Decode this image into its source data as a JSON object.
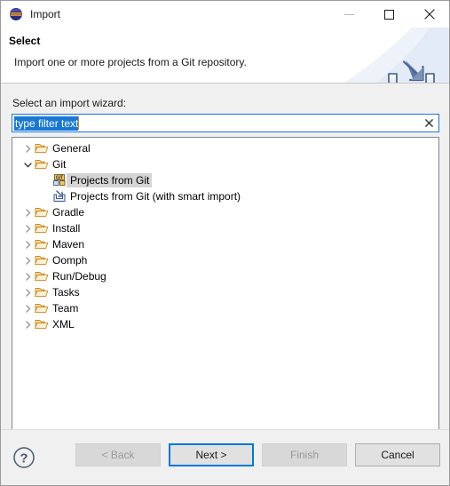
{
  "window": {
    "title": "Import",
    "app_icon": "eclipse-icon",
    "controls": [
      {
        "name": "minimize-button",
        "glyph": "minimize-icon",
        "enabled": false
      },
      {
        "name": "maximize-button",
        "glyph": "maximize-icon",
        "enabled": true
      },
      {
        "name": "close-button",
        "glyph": "close-icon",
        "enabled": true
      }
    ]
  },
  "header": {
    "title": "Select",
    "description": "Import one or more projects from a Git repository.",
    "icon": "import-wizard-icon"
  },
  "main": {
    "field_label": "Select an import wizard:",
    "filter": {
      "value": "type filter text",
      "placeholder": "type filter text",
      "selected": true,
      "clear_icon": "clear-x-icon"
    },
    "tree": [
      {
        "label": "General",
        "level": 1,
        "icon": "folder-icon",
        "expanded": false,
        "has_children": true,
        "selected": false
      },
      {
        "label": "Git",
        "level": 1,
        "icon": "folder-icon",
        "expanded": true,
        "has_children": true,
        "selected": false
      },
      {
        "label": "Projects from Git",
        "level": 2,
        "icon": "git-wizard-icon",
        "expanded": false,
        "has_children": false,
        "selected": true
      },
      {
        "label": "Projects from Git (with smart import)",
        "level": 2,
        "icon": "smart-import-icon",
        "expanded": false,
        "has_children": false,
        "selected": false
      },
      {
        "label": "Gradle",
        "level": 1,
        "icon": "folder-icon",
        "expanded": false,
        "has_children": true,
        "selected": false
      },
      {
        "label": "Install",
        "level": 1,
        "icon": "folder-icon",
        "expanded": false,
        "has_children": true,
        "selected": false
      },
      {
        "label": "Maven",
        "level": 1,
        "icon": "folder-icon",
        "expanded": false,
        "has_children": true,
        "selected": false
      },
      {
        "label": "Oomph",
        "level": 1,
        "icon": "folder-icon",
        "expanded": false,
        "has_children": true,
        "selected": false
      },
      {
        "label": "Run/Debug",
        "level": 1,
        "icon": "folder-icon",
        "expanded": false,
        "has_children": true,
        "selected": false
      },
      {
        "label": "Tasks",
        "level": 1,
        "icon": "folder-icon",
        "expanded": false,
        "has_children": true,
        "selected": false
      },
      {
        "label": "Team",
        "level": 1,
        "icon": "folder-icon",
        "expanded": false,
        "has_children": true,
        "selected": false
      },
      {
        "label": "XML",
        "level": 1,
        "icon": "folder-icon",
        "expanded": false,
        "has_children": true,
        "selected": false
      }
    ]
  },
  "footer": {
    "help_icon": "help-question-icon",
    "buttons": [
      {
        "label": "< Back",
        "name": "back-button",
        "state": "disabled"
      },
      {
        "label": "Next >",
        "name": "next-button",
        "state": "focused"
      },
      {
        "label": "Finish",
        "name": "finish-button",
        "state": "disabled"
      },
      {
        "label": "Cancel",
        "name": "cancel-button",
        "state": "enabled"
      }
    ]
  },
  "colors": {
    "accent": "#0078d7",
    "selection": "#1978d4",
    "dialog_bg": "#f0f0f0",
    "panel_bg": "#ffffff",
    "row_selected": "#d5d5d5",
    "folder": "#e9a93a"
  }
}
